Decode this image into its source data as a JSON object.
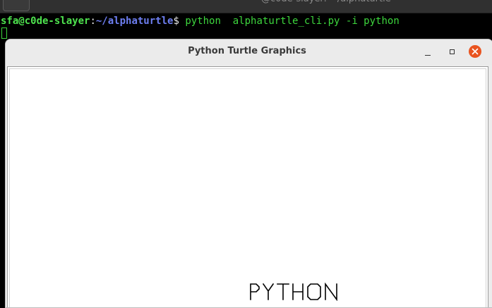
{
  "terminal": {
    "prompt_user": "sfa@c0de-slayer",
    "prompt_colon": ":",
    "prompt_path": "~/alphaturtle",
    "prompt_dollar": "$",
    "command": " python  alphaturtle_cli.py -i python"
  },
  "turtle_window": {
    "title": "Python Turtle Graphics",
    "drawn_text": "PYTHON"
  },
  "colors": {
    "close_button": "#e9541f",
    "prompt_user": "#4ee24e",
    "prompt_path": "#6d7ef0",
    "command": "#3dd63d"
  }
}
